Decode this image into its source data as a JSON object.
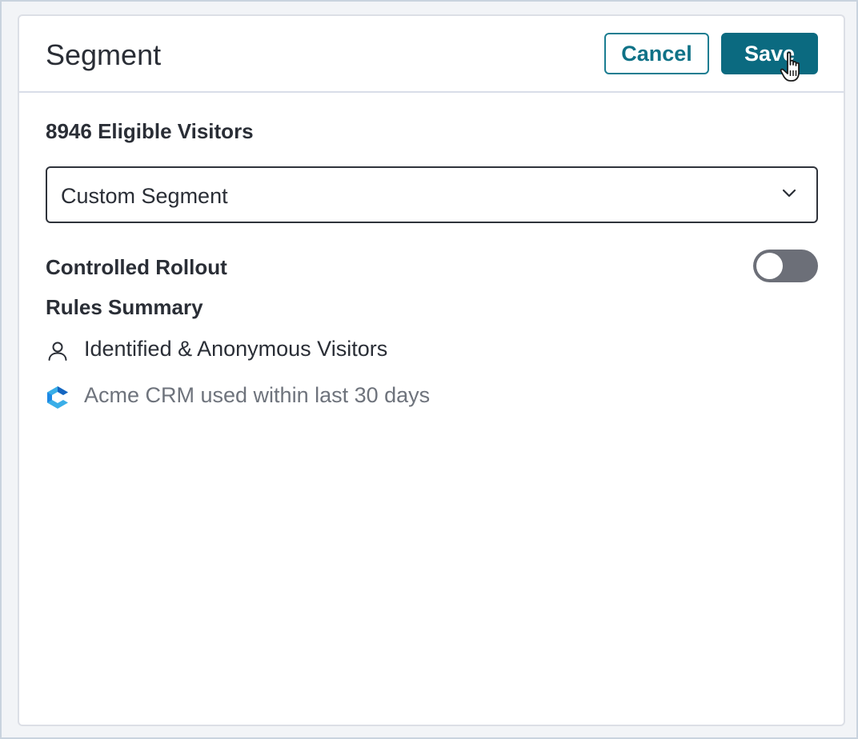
{
  "header": {
    "title": "Segment",
    "cancel_label": "Cancel",
    "save_label": "Save"
  },
  "eligible_visitors": "8946 Eligible Visitors",
  "segment_select": {
    "selected": "Custom Segment"
  },
  "controlled_rollout": {
    "label": "Controlled Rollout",
    "enabled": false
  },
  "rules_summary": {
    "heading": "Rules Summary",
    "rules": [
      {
        "icon": "person-icon",
        "text": "Identified & Anonymous Visitors"
      },
      {
        "icon": "acme-crm-logo-icon",
        "text": "Acme CRM used within last 30 days"
      }
    ]
  },
  "colors": {
    "primary": "#0b6a80",
    "primary_text": "#0f7287",
    "toggle_off": "#6c6f78",
    "text": "#2a2e36",
    "muted_text": "#6e737c",
    "crm_logo_light": "#3aaee8",
    "crm_logo_dark": "#1565c0"
  }
}
